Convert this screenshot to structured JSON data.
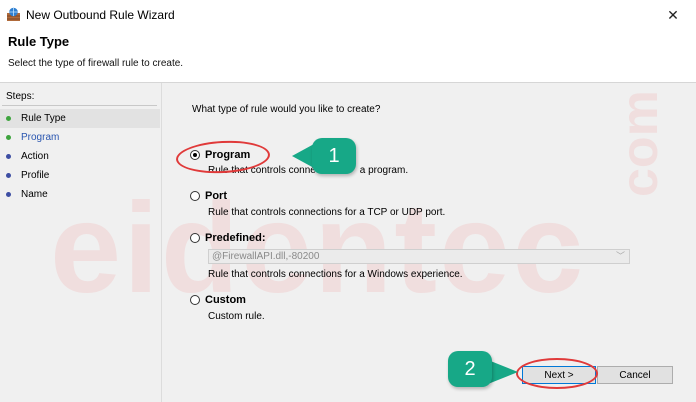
{
  "window": {
    "title": "New Outbound Rule Wizard",
    "close_glyph": "✕",
    "app_icon": "firewall-icon"
  },
  "header": {
    "title": "Rule Type",
    "subtitle": "Select the type of firewall rule to create."
  },
  "steps": {
    "label": "Steps:",
    "items": [
      {
        "label": "Rule Type",
        "dot": "#3ea43e",
        "active": true
      },
      {
        "label": "Program",
        "dot": "#3ea43e"
      },
      {
        "label": "Action",
        "dot": "#3d4ea3"
      },
      {
        "label": "Profile",
        "dot": "#3d4ea3"
      },
      {
        "label": "Name",
        "dot": "#3d4ea3"
      }
    ]
  },
  "main": {
    "question": "What type of rule would you like to create?",
    "options": [
      {
        "label": "Program",
        "desc": "Rule that controls connec              a program.",
        "checked": true
      },
      {
        "label": "Port",
        "desc": "Rule that controls connections for a TCP or UDP port."
      },
      {
        "label": "Predefined:",
        "desc": "Rule that controls connections for a Windows experience."
      },
      {
        "label": "Custom",
        "desc": "Custom rule."
      }
    ],
    "predefined_value": "@FirewallAPI.dll,-80200",
    "chevron": "﹀"
  },
  "buttons": {
    "next": "Next >",
    "cancel": "Cancel"
  },
  "annotations": {
    "callout1": "1",
    "callout2": "2",
    "color": "#17a887",
    "ring_color": "#e03a3a"
  },
  "watermark": {
    "text_main": "eidentec",
    "text_side": "com"
  }
}
